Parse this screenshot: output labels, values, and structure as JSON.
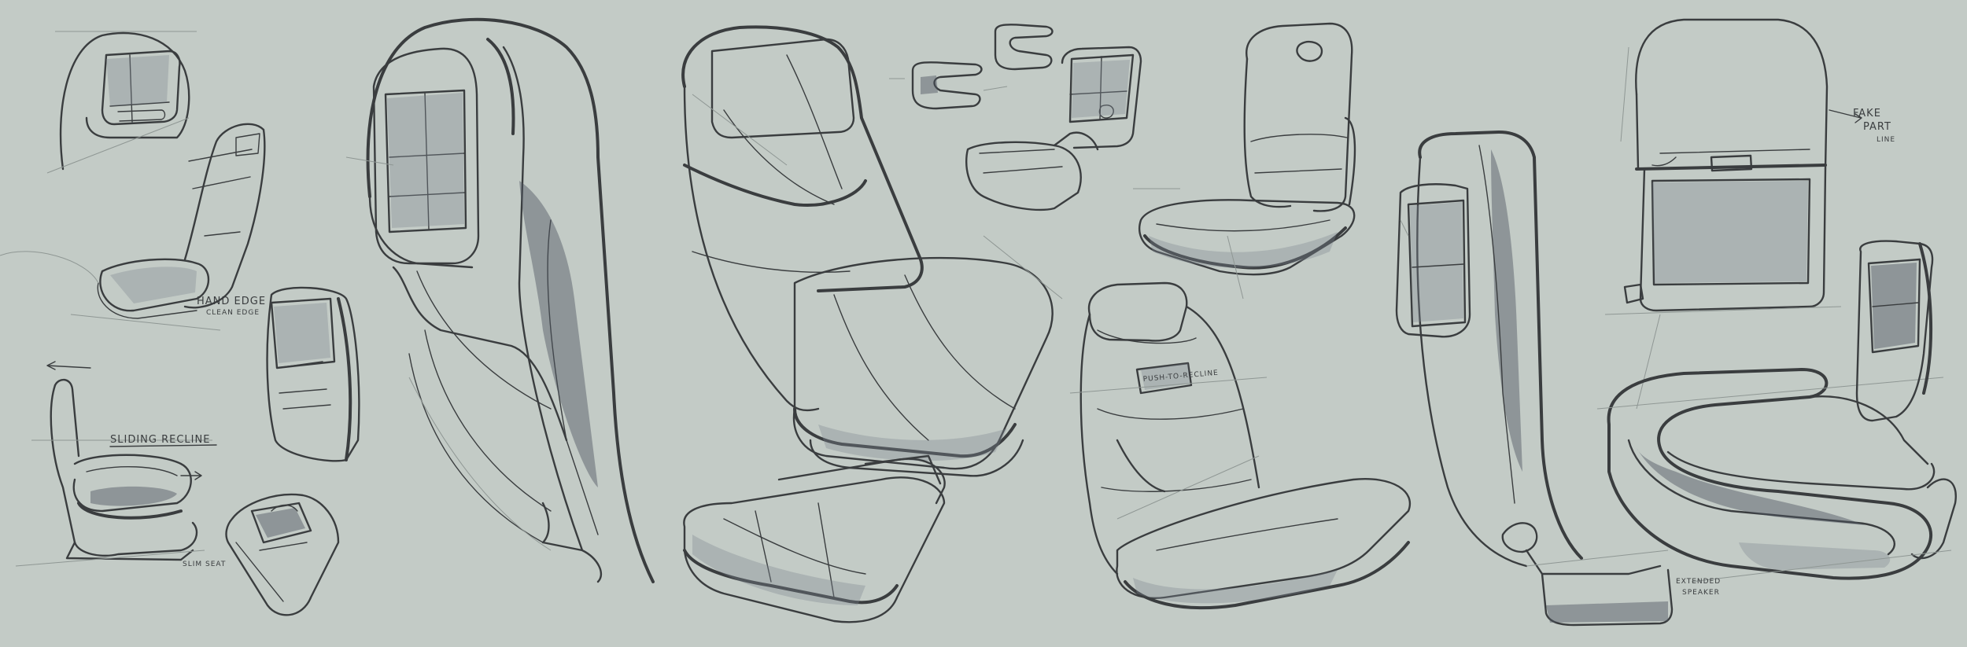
{
  "annotations": {
    "hand_edge": "HAND EDGE",
    "hand_edge_sub": "CLEAN EDGE",
    "sliding_recline": "SLIDING RECLINE",
    "slim_seat": "SLIM SEAT",
    "fake_part_1": "FAKE",
    "fake_part_2": "PART",
    "fake_part_3": "LINE",
    "extended_speaker_1": "EXTENDED",
    "extended_speaker_2": "SPEAKER",
    "backrest_badge": "PUSH-TO-RECLINE"
  },
  "palette": {
    "paper": "#c3cbc6",
    "ink": "#3a3d3f",
    "shade": "#7f8690"
  }
}
